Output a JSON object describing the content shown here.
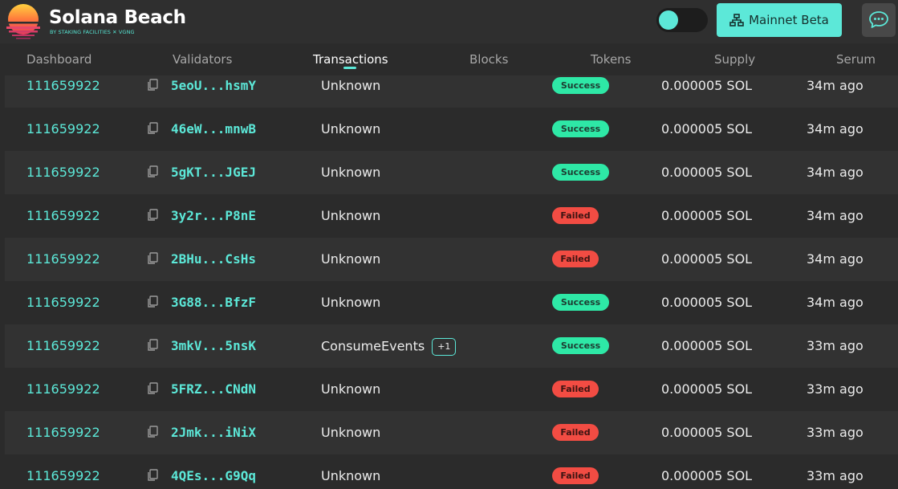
{
  "header": {
    "brand_title": "Solana Beach",
    "brand_subtitle": "BY STAKING FACILITIES ✕ VGNG",
    "network_label": "Mainnet Beta"
  },
  "nav": {
    "items": [
      "Dashboard",
      "Validators",
      "Transactions",
      "Blocks",
      "Tokens",
      "Supply",
      "Serum"
    ],
    "active": "Transactions"
  },
  "colors": {
    "accent": "#5ce8d8",
    "success": "#2ee8a6",
    "failed": "#f24c43",
    "background": "#2b2b2b"
  },
  "transactions": [
    {
      "block": "111659922",
      "signature": "5eoU...hsmY",
      "type": "Unknown",
      "extra": "",
      "status": "Success",
      "fee": "0.000005 SOL",
      "time": "34m ago"
    },
    {
      "block": "111659922",
      "signature": "46eW...mnwB",
      "type": "Unknown",
      "extra": "",
      "status": "Success",
      "fee": "0.000005 SOL",
      "time": "34m ago"
    },
    {
      "block": "111659922",
      "signature": "5gKT...JGEJ",
      "type": "Unknown",
      "extra": "",
      "status": "Success",
      "fee": "0.000005 SOL",
      "time": "34m ago"
    },
    {
      "block": "111659922",
      "signature": "3y2r...P8nE",
      "type": "Unknown",
      "extra": "",
      "status": "Failed",
      "fee": "0.000005 SOL",
      "time": "34m ago"
    },
    {
      "block": "111659922",
      "signature": "2BHu...CsHs",
      "type": "Unknown",
      "extra": "",
      "status": "Failed",
      "fee": "0.000005 SOL",
      "time": "34m ago"
    },
    {
      "block": "111659922",
      "signature": "3G88...BfzF",
      "type": "Unknown",
      "extra": "",
      "status": "Success",
      "fee": "0.000005 SOL",
      "time": "34m ago"
    },
    {
      "block": "111659922",
      "signature": "3mkV...5nsK",
      "type": "ConsumeEvents",
      "extra": "+1",
      "status": "Success",
      "fee": "0.000005 SOL",
      "time": "33m ago"
    },
    {
      "block": "111659922",
      "signature": "5FRZ...CNdN",
      "type": "Unknown",
      "extra": "",
      "status": "Failed",
      "fee": "0.000005 SOL",
      "time": "33m ago"
    },
    {
      "block": "111659922",
      "signature": "2Jmk...iNiX",
      "type": "Unknown",
      "extra": "",
      "status": "Failed",
      "fee": "0.000005 SOL",
      "time": "33m ago"
    },
    {
      "block": "111659922",
      "signature": "4QEs...G9Qq",
      "type": "Unknown",
      "extra": "",
      "status": "Failed",
      "fee": "0.000005 SOL",
      "time": "33m ago"
    }
  ]
}
